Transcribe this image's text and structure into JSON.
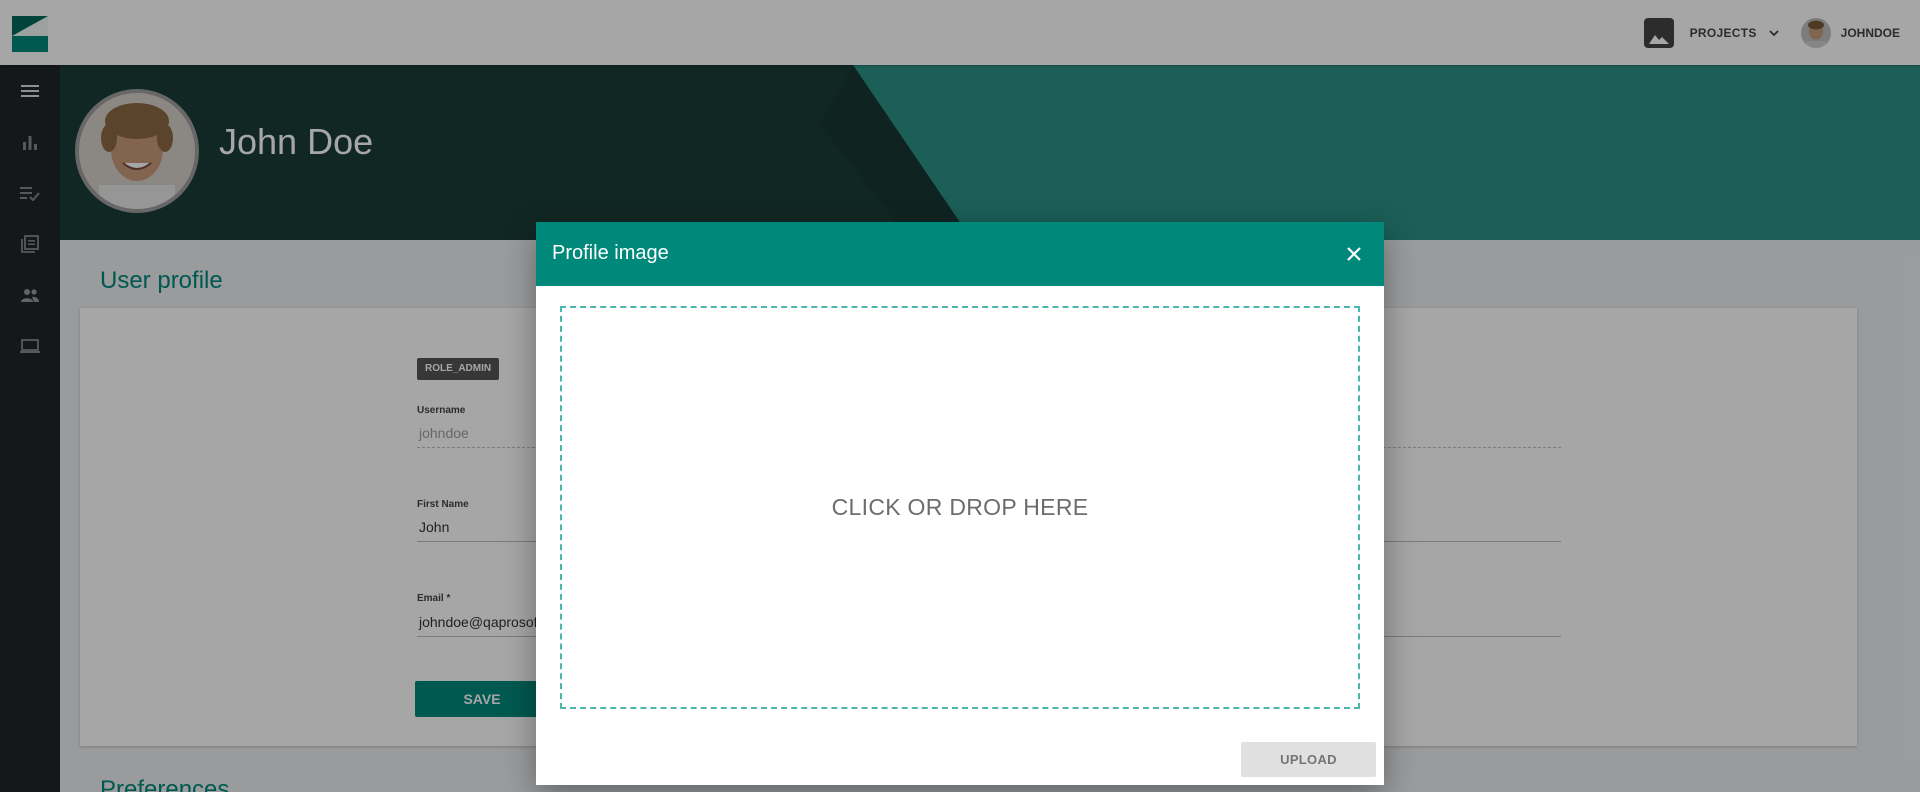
{
  "topbar": {
    "projects_label": "PROJECTS",
    "user_label": "JOHNDOE"
  },
  "sidebar": {
    "items": [
      {
        "icon": "menu-icon"
      },
      {
        "icon": "bar-chart-icon"
      },
      {
        "icon": "checklist-icon"
      },
      {
        "icon": "library-icon"
      },
      {
        "icon": "people-icon"
      },
      {
        "icon": "laptop-icon"
      }
    ]
  },
  "hero": {
    "name": "John Doe"
  },
  "profile": {
    "section_title": "User profile",
    "role_badge": "ROLE_ADMIN",
    "username_label": "Username",
    "username_value": "johndoe",
    "first_name_label": "First Name",
    "first_name_value": "John",
    "email_label": "Email *",
    "email_value": "johndoe@qaprosof",
    "save_label": "SAVE",
    "next_section_title": "Preferences"
  },
  "modal": {
    "title": "Profile image",
    "dropzone_text": "CLICK OR DROP HERE",
    "upload_label": "UPLOAD"
  },
  "colors": {
    "accent": "#00897b",
    "sidebar": "#212529",
    "dropzone_border": "#4db6ac"
  }
}
